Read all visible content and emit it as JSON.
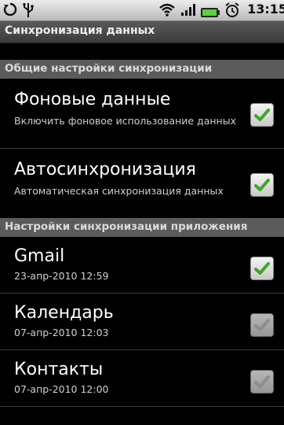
{
  "status": {
    "time": "13:15"
  },
  "title": "Синхронизация данных",
  "sections": {
    "general": "Общие настройки синхронизации",
    "apps": "Настройки синхронизации приложения"
  },
  "rows": [
    {
      "title": "Фоновые данные",
      "sub": "Включить фоновое использование данных",
      "checked": true
    },
    {
      "title": "Автосинхронизация",
      "sub": "Автоматическая синхронизация данных",
      "checked": true
    },
    {
      "title": "Gmail",
      "sub": "23-апр-2010 12:59",
      "checked": true
    },
    {
      "title": "Календарь",
      "sub": "07-апр-2010 12:03",
      "checked": false
    },
    {
      "title": "Контакты",
      "sub": "07-апр-2010 12:00",
      "checked": false
    }
  ],
  "colors": {
    "check_on": "#3fa62a",
    "check_off": "#bdbdbd"
  }
}
